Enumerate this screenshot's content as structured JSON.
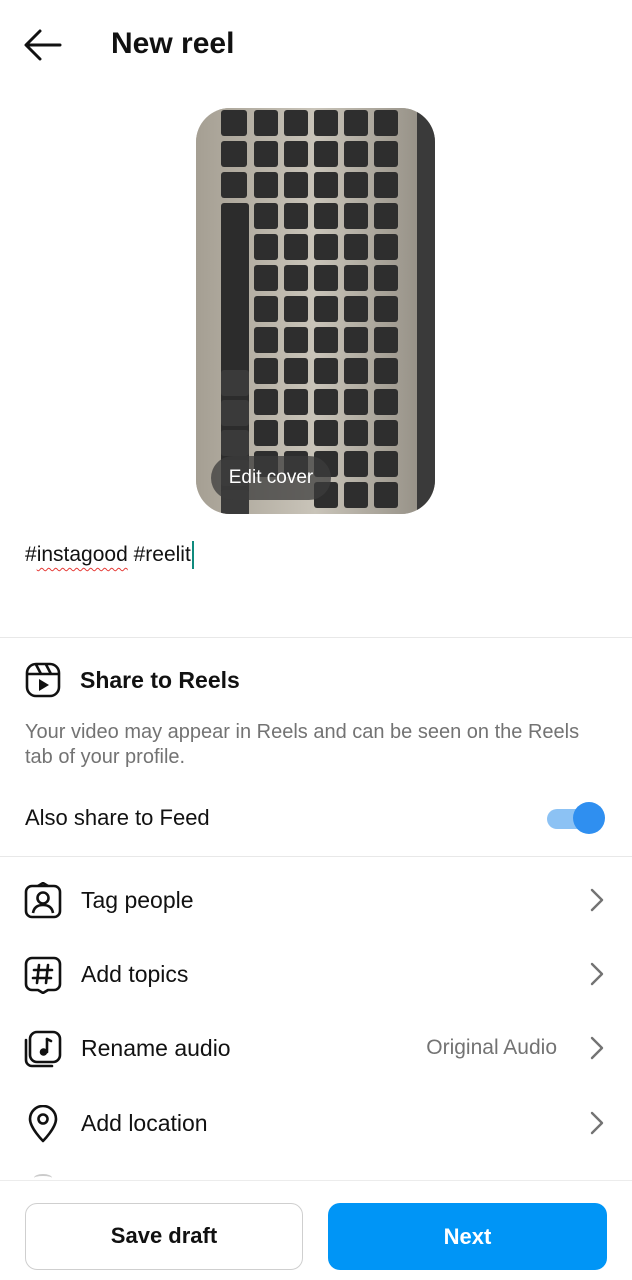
{
  "header": {
    "title": "New reel",
    "back_icon": "arrow-left-icon"
  },
  "cover": {
    "edit_label": "Edit cover",
    "image_alt": "keyboard-photo"
  },
  "caption": {
    "tag1": "#instagood",
    "tag2": "#reelit"
  },
  "share_to_reels": {
    "title": "Share to Reels",
    "description": "Your video may appear in Reels and can be seen on the Reels tab of your profile.",
    "icon": "reels-icon"
  },
  "feed": {
    "label": "Also share to Feed",
    "enabled": true
  },
  "menu": {
    "items": [
      {
        "label": "Tag people",
        "icon": "tag-people-icon",
        "value": ""
      },
      {
        "label": "Add topics",
        "icon": "hashtag-icon",
        "value": ""
      },
      {
        "label": "Rename audio",
        "icon": "music-note-icon",
        "value": "Original Audio"
      },
      {
        "label": "Add location",
        "icon": "location-pin-icon",
        "value": ""
      }
    ]
  },
  "footer": {
    "save_label": "Save draft",
    "next_label": "Next"
  },
  "colors": {
    "accent": "#0095f6",
    "toggle_thumb": "#2f8ff0",
    "toggle_track": "#8cc2f4",
    "secondary_text": "#737373"
  }
}
